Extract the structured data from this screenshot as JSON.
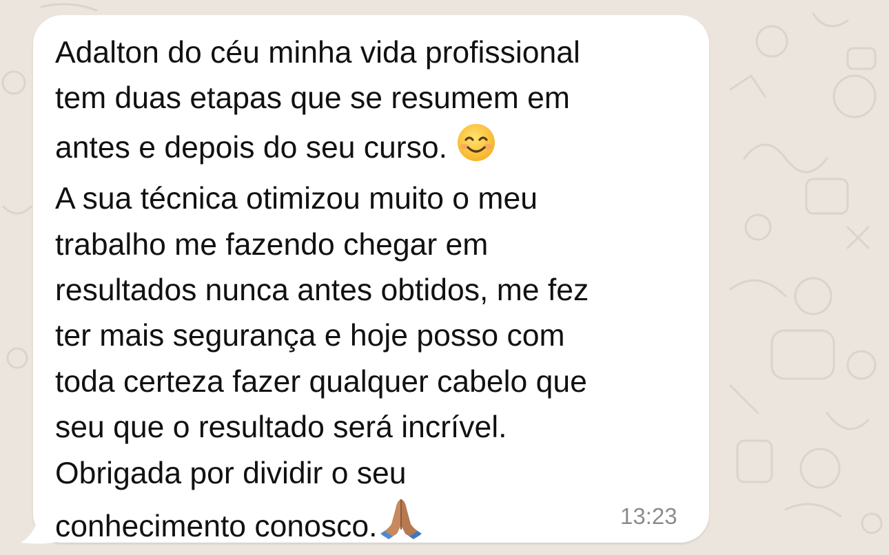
{
  "message": {
    "lines": [
      "Adalton do céu minha vida profissional",
      "tem duas etapas que se resumem em",
      "antes e depois do seu curso. ",
      "A sua técnica otimizou muito o meu",
      "trabalho me fazendo chegar em",
      "resultados nunca antes obtidos, me fez",
      "ter mais segurança e hoje posso com",
      "toda certeza fazer qualquer cabelo que",
      "seu que o resultado será incrível.",
      "Obrigada por dividir o seu",
      "conhecimento conosco."
    ],
    "emojis": [
      "smiling-face-with-smiling-eyes",
      "folded-hands"
    ],
    "time": "13:23"
  },
  "colors": {
    "background": "#ece5dd",
    "bubble": "#ffffff",
    "text": "#111111",
    "timestamp": "#8c8c8c"
  }
}
